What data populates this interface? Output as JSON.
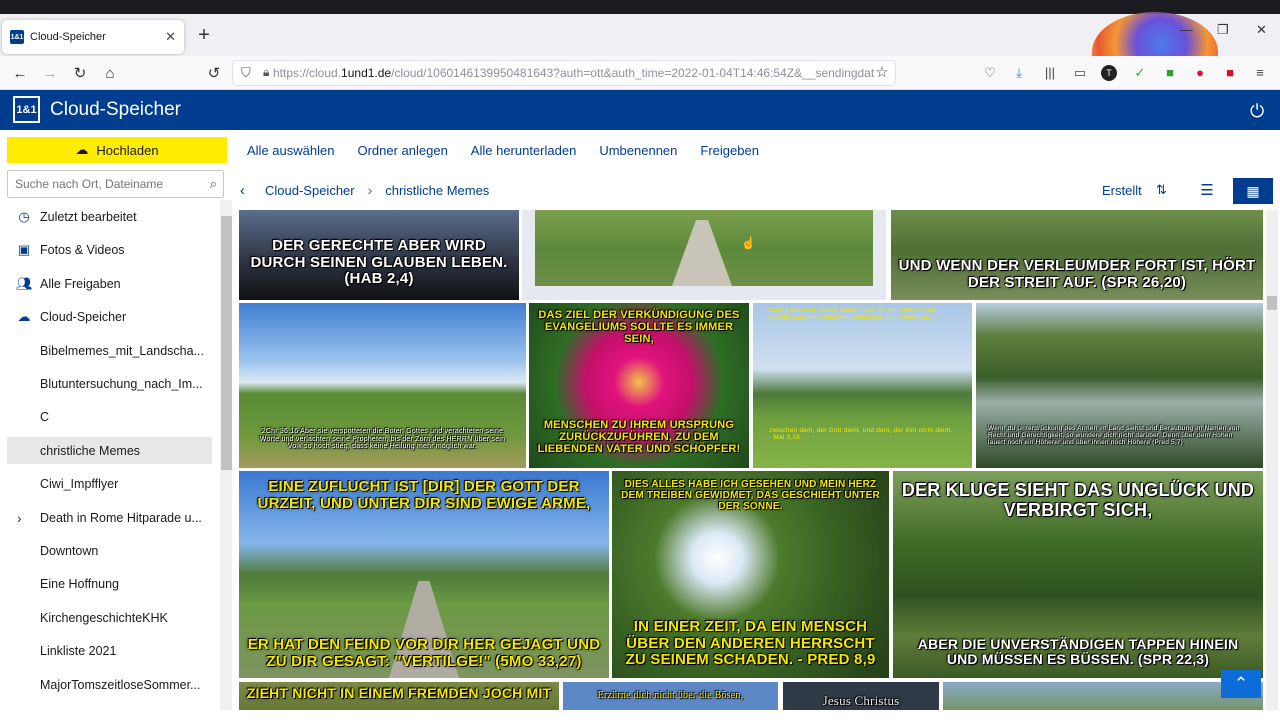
{
  "browser": {
    "tab_title": "Cloud-Speicher",
    "tab_favicon": "1&1",
    "url_domain": "https://cloud.",
    "url_host": "1und1.de",
    "url_rest": "/cloud/1060146139950481643?auth=ott&auth_time=2022-01-04T14:46:54Z&__sendingdat"
  },
  "app": {
    "logo": "1&1",
    "title": "Cloud-Speicher",
    "brand_color": "#003d8f",
    "accent_color": "#ffec00"
  },
  "sidebar": {
    "upload_label": "Hochladen",
    "search_placeholder": "Suche nach Ort, Dateiname",
    "items": [
      {
        "label": "Zuletzt bearbeitet",
        "icon": "clock-icon"
      },
      {
        "label": "Fotos & Videos",
        "icon": "image-icon"
      },
      {
        "label": "Alle Freigaben",
        "icon": "users-icon"
      },
      {
        "label": "Cloud-Speicher",
        "icon": "cloud-icon"
      }
    ],
    "folders": [
      "Bibelmemes_mit_Landscha...",
      "Blutuntersuchung_nach_Im...",
      "C",
      "christliche Memes",
      "Ciwi_Impfflyer",
      "Death in Rome Hitparade u...",
      "Downtown",
      "Eine Hoffnung",
      "KirchengeschichteKHK",
      "Linkliste 2021",
      "MajorTomszeitloseSommer..."
    ]
  },
  "toolbar": {
    "select_all": "Alle auswählen",
    "new_folder": "Ordner anlegen",
    "download_all": "Alle herunterladen",
    "rename": "Umbenennen",
    "share": "Freigeben"
  },
  "breadcrumb": {
    "root": "Cloud-Speicher",
    "current": "christliche Memes"
  },
  "sort": {
    "label": "Erstellt"
  },
  "images": {
    "r1a": "DER GERECHTE ABER WIRD DURCH SEINEN GLAUBEN LEBEN. (HAB 2,4)",
    "r1c": "UND WENN DER VERLEUMDER FORT IST, HÖRT DER STREIT AUF. (SPR 26,20)",
    "r2a": "2Chr 36,16 Aber sie verspotteten die Boten Gottes und verachteten seine Worte und verlachten seine Propheten, bis der Zorn des HERRN über sein Volk so hoch stieg, dass keine Heilung mehr möglich war.",
    "r2b_top": "DAS ZIEL DER VERKÜNDIGUNG DES EVANGELIUMS SOLLTE ES IMMER SEIN,",
    "r2b_bottom": "MENSCHEN ZU IHREM URSPRUNG ZURÜCKZUFÜHREN, ZU DEM LIEBENDEN VATER UND SCHÖPFER!",
    "r2c_top": "Dann werdet ihr wieder sehen, was für ein Unterschied besteht zwischen dem Gerechten und dem Gottlosen,",
    "r2c_bottom": "zwischen dem, der Gott dient, und dem, der ihm nicht dient. - Mal 3,18",
    "r2d": "Wenn du Unterdrückung des Armen im Land siehst und Beraubung im Namen von Recht und Gerechtigkeit, so wundere dich nicht darüber. Denn über dem Hohen lauert noch ein Höherer und über ihnen noch Höhere (Pred 5,7)",
    "r3a_top": "EINE ZUFLUCHT IST [DIR] DER GOTT DER URZEIT, UND UNTER DIR SIND EWIGE ARME,",
    "r3a_bottom": "ER HAT DEN FEIND VOR DIR HER GEJAGT UND ZU DIR GESAGT: \"VERTILGE!\" (5MO 33,27)",
    "r3b_top": "DIES ALLES HABE ICH GESEHEN UND MEIN HERZ DEM TREIBEN GEWIDMET, DAS GESCHIEHT UNTER DER SONNE.",
    "r3b_bottom": "IN EINER ZEIT, DA EIN MENSCH ÜBER DEN ANDEREN HERRSCHT ZU SEINEM SCHADEN. - PRED 8,9",
    "r3c_top": "DER KLUGE SIEHT DAS UNGLÜCK UND VERBIRGT SICH,",
    "r3c_bottom": "ABER DIE UNVERSTÄNDIGEN TAPPEN HINEIN UND MÜSSEN ES BÜSSEN. (SPR 22,3)",
    "r4a": "ZIEHT NICHT IN EINEM FREMDEN JOCH MIT",
    "r4b": "Erzürne dich nicht über die Bösen,",
    "r4c": "Jesus Christus"
  }
}
